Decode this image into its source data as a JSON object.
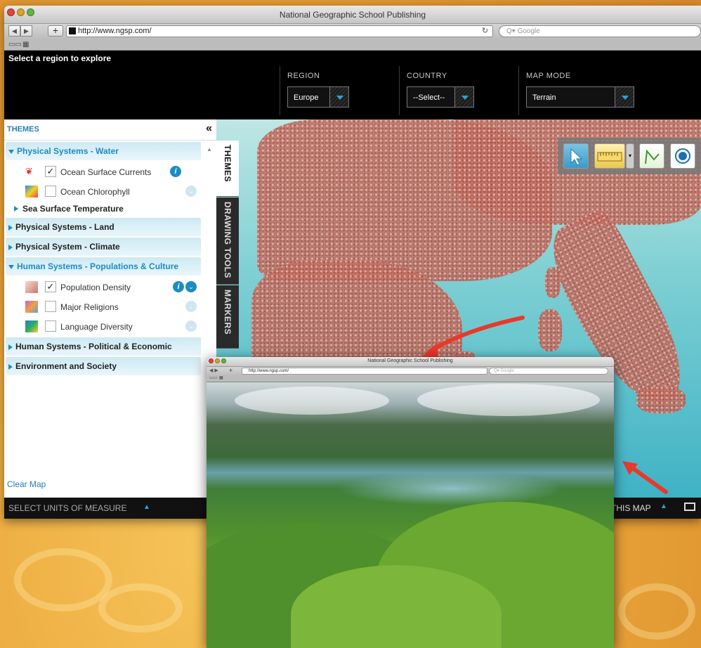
{
  "browser": {
    "title": "National Geographic School Publishing",
    "url": "http://www.ngsp.com/",
    "search_placeholder": "Q▾ Google",
    "bookmarks_icon": "book-icon",
    "grid_icon": "grid-icon"
  },
  "header": {
    "tagline": "Select a region to explore",
    "region": {
      "label": "REGION",
      "value": "Europe"
    },
    "country": {
      "label": "COUNTRY",
      "value": "--Select--"
    },
    "map_mode": {
      "label": "MAP MODE",
      "value": "Terrain"
    }
  },
  "sidebar": {
    "title": "THEMES",
    "collapse_glyph": "«",
    "sections": [
      {
        "label": "Physical Systems - Water",
        "open": true
      },
      {
        "label": "Physical Systems - Land",
        "open": false
      },
      {
        "label": "Physical System - Climate",
        "open": false
      },
      {
        "label": "Human Systems - Populations & Culture",
        "open": true
      },
      {
        "label": "Human Systems - Political & Economic",
        "open": false
      },
      {
        "label": "Environment and Society",
        "open": false
      }
    ],
    "water_items": [
      {
        "label": "Ocean Surface Currents",
        "checked": true,
        "info": "i"
      },
      {
        "label": "Ocean Chlorophyll",
        "checked": false
      }
    ],
    "water_subhead": "Sea Surface Temperature",
    "population_items": [
      {
        "label": "Population Density",
        "checked": true,
        "info": "i"
      },
      {
        "label": "Major Religions",
        "checked": false
      },
      {
        "label": "Language Diversity",
        "checked": false
      }
    ],
    "checkmark": "✓",
    "clear_map": "Clear Map"
  },
  "tabs": {
    "themes": "THEMES",
    "drawing_tools": "DRAWING TOOLS",
    "markers": "MARKERS"
  },
  "bottom": {
    "units": "SELECT UNITS OF MEASURE",
    "this_map": "THIS MAP",
    "up_glyph": "▲"
  },
  "popup": {
    "title": "National Geographic School Publishing",
    "url": "http://www.ngsp.com/",
    "search_placeholder": "Q▾ Google"
  },
  "colors": {
    "accent": "#1d8cc1",
    "land": "#c37367",
    "sea": "#3fb2c5",
    "arrow": "#e8392a"
  }
}
